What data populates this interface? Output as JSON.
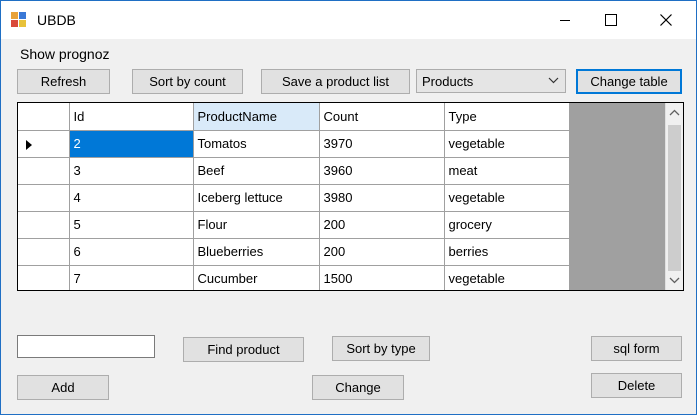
{
  "window": {
    "title": "UBDB",
    "minimize_icon": "minimize-icon",
    "maximize_icon": "maximize-icon",
    "close_icon": "close-icon"
  },
  "menu": {
    "label": "Show prognoz"
  },
  "toolbar": {
    "refresh_label": "Refresh",
    "sort_by_count_label": "Sort by count",
    "save_product_list_label": "Save a product list",
    "table_select_value": "Products",
    "change_table_label": "Change table"
  },
  "grid": {
    "columns": [
      "Id",
      "ProductName",
      "Count",
      "Type"
    ],
    "rows": [
      {
        "id": "2",
        "name": "Tomatos",
        "count": "3970",
        "type": "vegetable"
      },
      {
        "id": "3",
        "name": "Beef",
        "count": "3960",
        "type": "meat"
      },
      {
        "id": "4",
        "name": "Iceberg lettuce",
        "count": "3980",
        "type": "vegetable"
      },
      {
        "id": "5",
        "name": "Flour",
        "count": "200",
        "type": "grocery"
      },
      {
        "id": "6",
        "name": "Blueberries",
        "count": "200",
        "type": "berries"
      },
      {
        "id": "7",
        "name": "Cucumber",
        "count": "1500",
        "type": "vegetable"
      }
    ]
  },
  "search": {
    "value": ""
  },
  "actions": {
    "find_product_label": "Find product",
    "sort_by_type_label": "Sort by type",
    "sql_form_label": "sql form",
    "add_label": "Add",
    "change_label": "Change",
    "delete_label": "Delete"
  },
  "colors": {
    "selection": "#0078d7",
    "header_selected": "#d9eaf9",
    "grid_background": "#a0a0a0"
  }
}
